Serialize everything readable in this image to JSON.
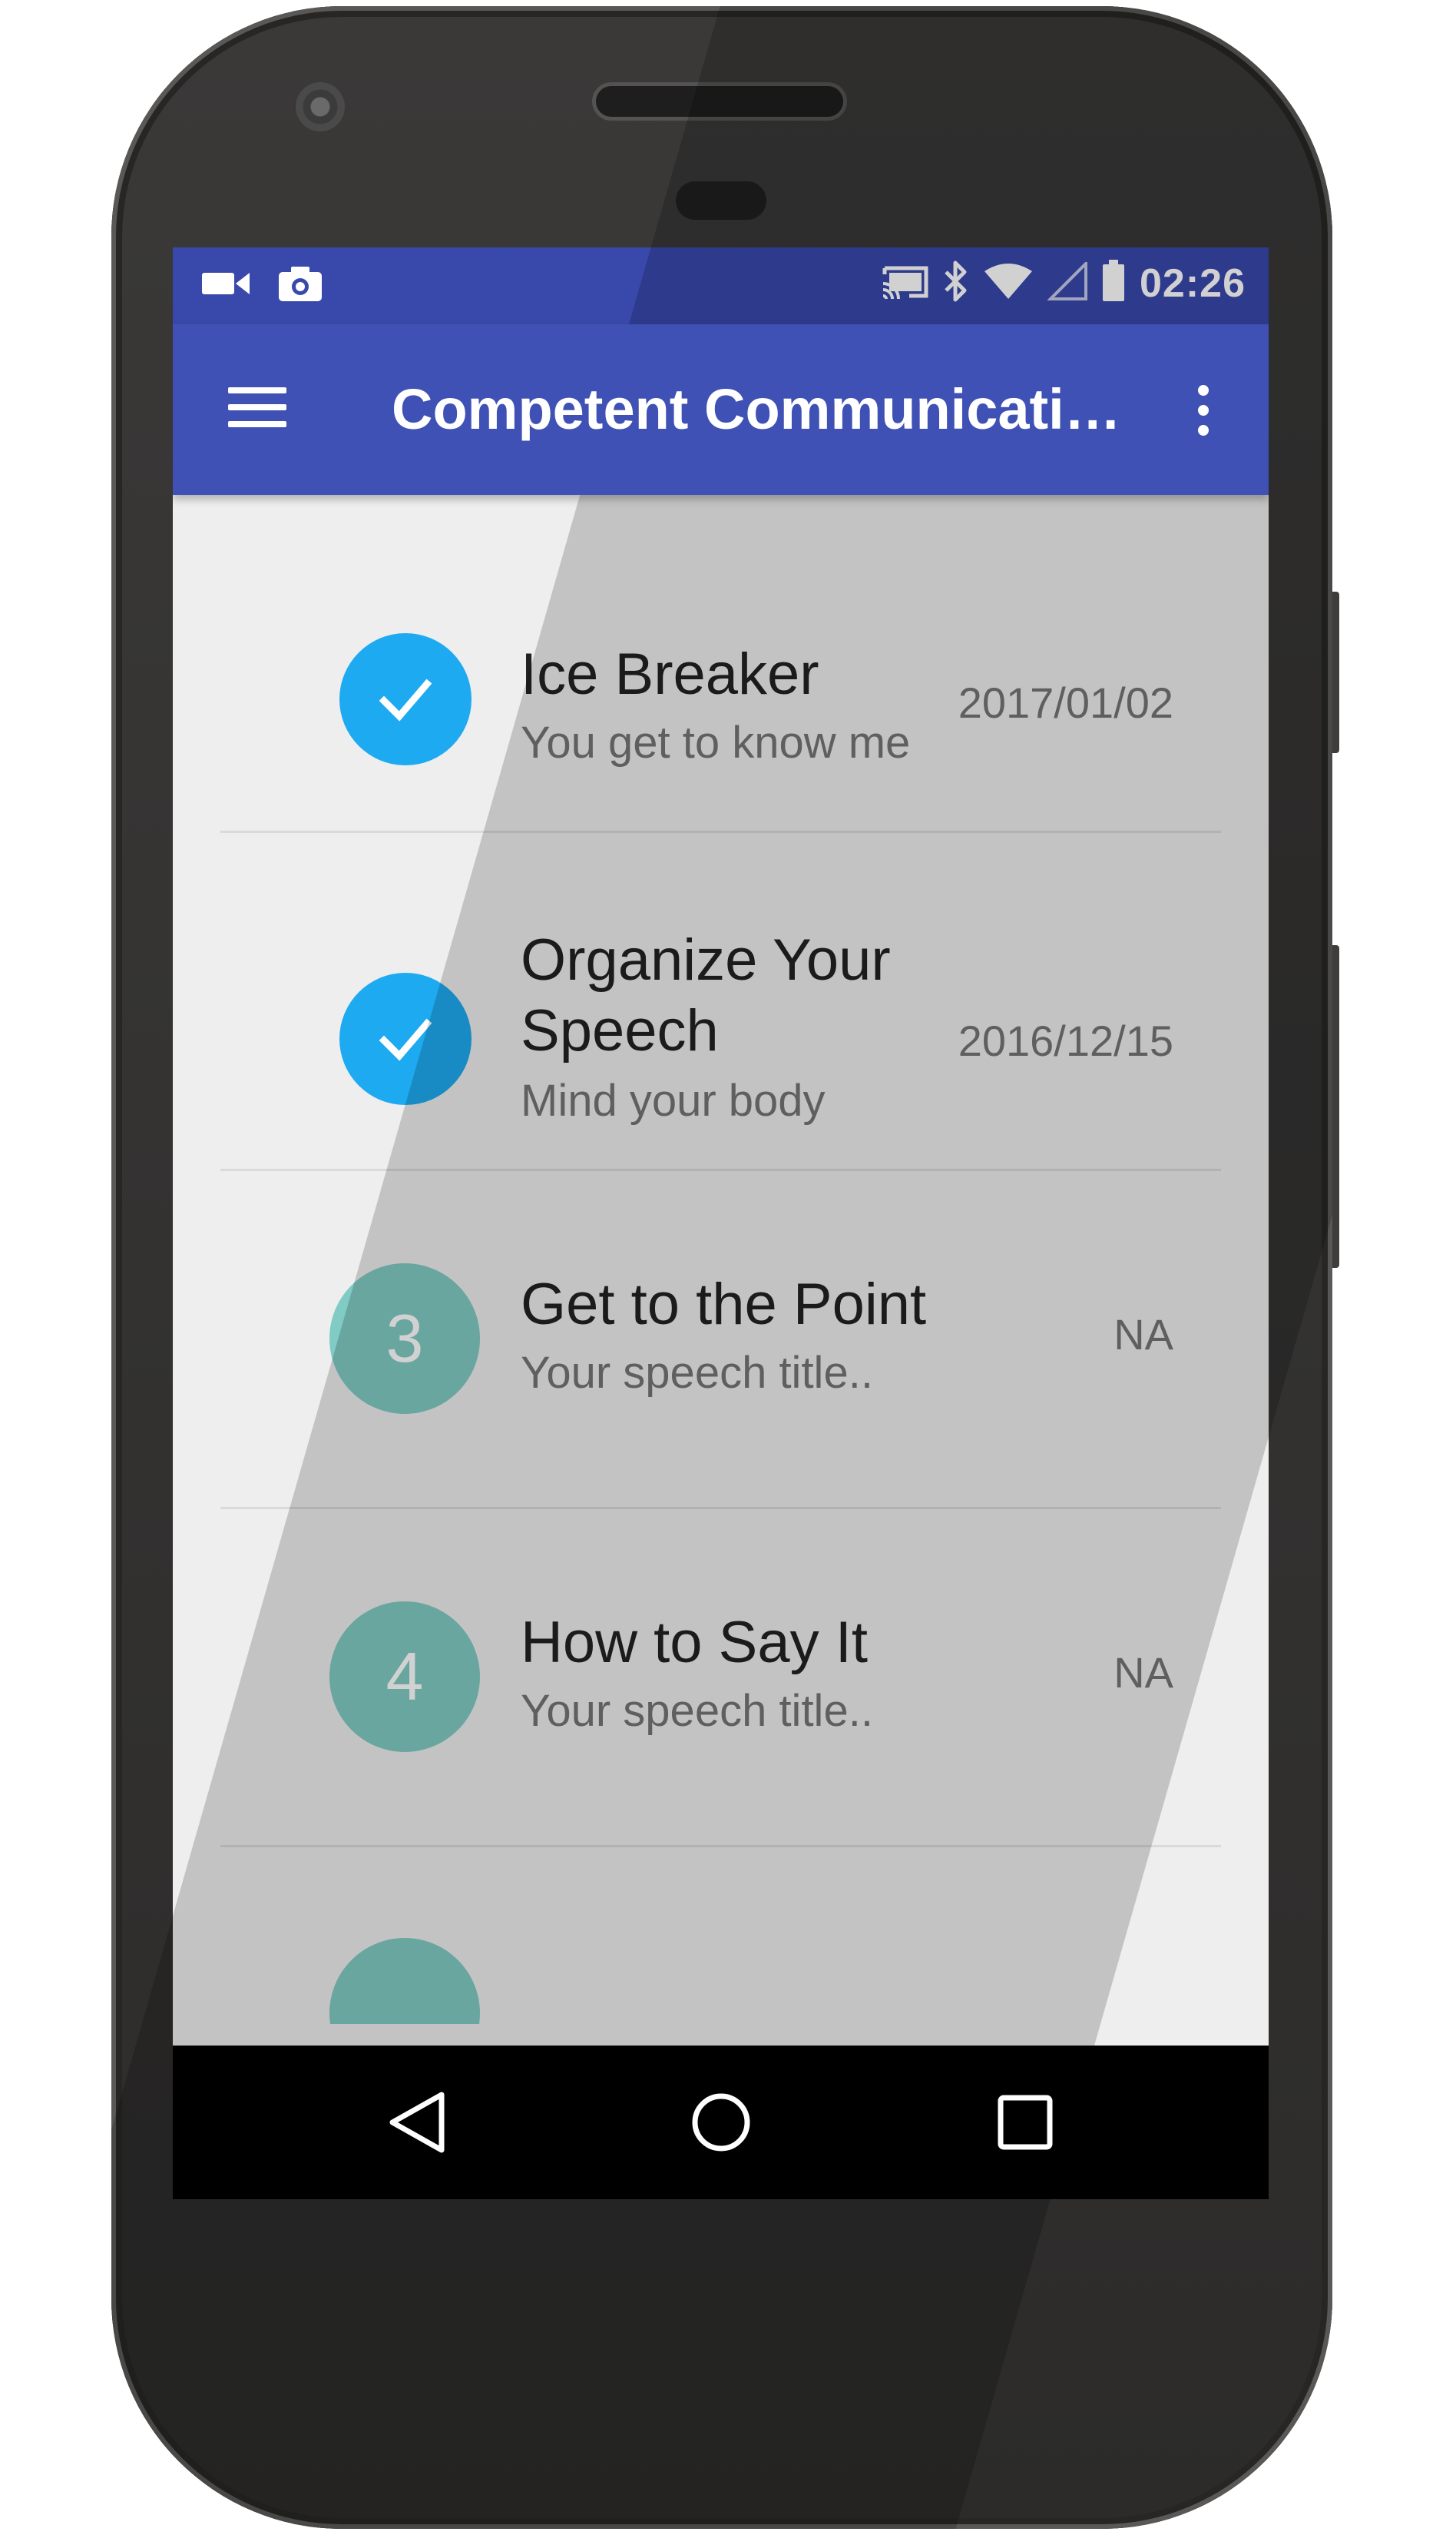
{
  "status_bar": {
    "time": "02:26",
    "left_icons": [
      "video-camera-icon",
      "camera-icon"
    ],
    "right_icons": [
      "cast-icon",
      "bluetooth-icon",
      "wifi-icon",
      "cell-signal-icon",
      "battery-icon"
    ]
  },
  "app_bar": {
    "title": "Competent Communicati…",
    "nav_icon": "hamburger-menu-icon",
    "overflow_icon": "more-vert-icon"
  },
  "list": {
    "items": [
      {
        "status": "completed",
        "badge_icon": "check-icon",
        "title_line1": "Ice Breaker",
        "title_line2": "",
        "subtitle": "You get to know me",
        "date": "2017/01/02"
      },
      {
        "status": "completed",
        "badge_icon": "check-icon",
        "title_line1": "Organize Your",
        "title_line2": "Speech",
        "subtitle": "Mind your body",
        "date": "2016/12/15"
      },
      {
        "status": "pending",
        "badge_number": "3",
        "title_line1": "Get to the Point",
        "title_line2": "",
        "subtitle": "Your speech title..",
        "date": "NA"
      },
      {
        "status": "pending",
        "badge_number": "4",
        "title_line1": "How to Say It",
        "title_line2": "",
        "subtitle": "Your speech title..",
        "date": "NA"
      }
    ]
  },
  "nav_bar": {
    "buttons": [
      "back-icon",
      "home-icon",
      "recents-icon"
    ]
  },
  "colors": {
    "status_bar": "#3949ab",
    "app_bar": "#3f51b5",
    "completed_badge": "#1eaaf1",
    "pending_badge": "#80cbc4",
    "list_background": "#eeeeee"
  }
}
